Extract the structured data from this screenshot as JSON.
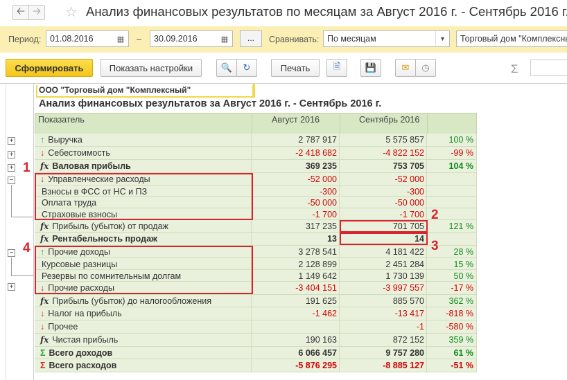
{
  "window": {
    "title": "Анализ финансовых результатов по месяцам за Август 2016 г. - Сентябрь 2016 г.",
    "back_icon": "arrow-left-icon",
    "forward_icon": "arrow-right-icon",
    "favorite_icon": "star-icon"
  },
  "settings": {
    "period_label": "Период:",
    "date_from": "01.08.2016",
    "dash": "–",
    "date_to": "30.09.2016",
    "dots_label": "...",
    "compare_label": "Сравнивать:",
    "compare_value": "По месяцам",
    "organization_value": "Торговый дом \"Комплексный\""
  },
  "toolbar": {
    "generate_label": "Сформировать",
    "show_settings_label": "Показать настройки",
    "print_label": "Печать",
    "sigma": "Σ"
  },
  "report": {
    "company": "ООО \"Торговый дом \"Комплексный\"",
    "title": "Анализ финансовых результатов за Август 2016 г. - Сентябрь 2016 г.",
    "col_indicator": "Показатель",
    "col_aug": "Август 2016",
    "col_sep": "Сентябрь 2016",
    "rows": [
      {
        "icon": "up",
        "name": "Выручка",
        "aug": "2 787 917",
        "sep": "5 575 857",
        "pct": "100 %",
        "bold": false,
        "neg": false
      },
      {
        "icon": "down",
        "name": "Себестоимость",
        "aug": "-2 418 682",
        "sep": "-4 822 152",
        "pct": "-99 %",
        "bold": false,
        "neg": true
      },
      {
        "icon": "fx",
        "name": "Валовая прибыль",
        "aug": "369 235",
        "sep": "753 705",
        "pct": "104 %",
        "bold": true,
        "neg": false
      },
      {
        "icon": "down",
        "name": "Управленческие расходы",
        "aug": "-52 000",
        "sep": "-52 000",
        "pct": "",
        "bold": false,
        "neg": true
      },
      {
        "icon": "",
        "name": "Взносы в ФСС от НС и ПЗ",
        "aug": "-300",
        "sep": "-300",
        "pct": "",
        "bold": false,
        "neg": true
      },
      {
        "icon": "",
        "name": "Оплата труда",
        "aug": "-50 000",
        "sep": "-50 000",
        "pct": "",
        "bold": false,
        "neg": true
      },
      {
        "icon": "",
        "name": "Страховые взносы",
        "aug": "-1 700",
        "sep": "-1 700",
        "pct": "",
        "bold": false,
        "neg": true
      },
      {
        "icon": "fx",
        "name": "Прибыль (убыток) от продаж",
        "aug": "317 235",
        "sep": "701 705",
        "pct": "121 %",
        "bold": false,
        "neg": false
      },
      {
        "icon": "fx",
        "name": "Рентабельность продаж",
        "aug": "13",
        "sep": "14",
        "pct": "",
        "bold": true,
        "neg": false
      },
      {
        "icon": "up",
        "name": "Прочие доходы",
        "aug": "3 278 541",
        "sep": "4 181 422",
        "pct": "28 %",
        "bold": false,
        "neg": false
      },
      {
        "icon": "",
        "name": "Курсовые разницы",
        "aug": "2 128 899",
        "sep": "2 451 284",
        "pct": "15 %",
        "bold": false,
        "neg": false
      },
      {
        "icon": "",
        "name": "Резервы по сомнительным долгам",
        "aug": "1 149 642",
        "sep": "1 730 139",
        "pct": "50 %",
        "bold": false,
        "neg": false
      },
      {
        "icon": "down",
        "name": "Прочие расходы",
        "aug": "-3 404 151",
        "sep": "-3 997 557",
        "pct": "-17 %",
        "bold": false,
        "neg": true
      },
      {
        "icon": "fx",
        "name": "Прибыль (убыток) до налогообложения",
        "aug": "191 625",
        "sep": "885 570",
        "pct": "362 %",
        "bold": false,
        "neg": false
      },
      {
        "icon": "down",
        "name": "Налог на прибыль",
        "aug": "-1 462",
        "sep": "-13 417",
        "pct": "-818 %",
        "bold": false,
        "neg": true
      },
      {
        "icon": "down",
        "name": "Прочее",
        "aug": "",
        "sep": "-1",
        "pct": "-580 %",
        "bold": false,
        "neg": true
      },
      {
        "icon": "fx",
        "name": "Чистая прибыль",
        "aug": "190 163",
        "sep": "872 152",
        "pct": "359 %",
        "bold": false,
        "neg": false
      },
      {
        "icon": "sumg",
        "name": "Всего доходов",
        "aug": "6 066 457",
        "sep": "9 757 280",
        "pct": "61 %",
        "bold": true,
        "neg": false
      },
      {
        "icon": "sumr",
        "name": "Всего расходов",
        "aug": "-5 876 295",
        "sep": "-8 885 127",
        "pct": "-51 %",
        "bold": true,
        "neg": true
      }
    ]
  },
  "annotations": {
    "n1": "1",
    "n2": "2",
    "n3": "3",
    "n4": "4"
  },
  "colors": {
    "accent_yellow": "#f4c51a",
    "row_green": "#e9f1dc",
    "header_green": "#d8e8c4",
    "negative_red": "#d40000",
    "percent_green": "#0c8a1a",
    "annotation_red": "#d9232d"
  }
}
